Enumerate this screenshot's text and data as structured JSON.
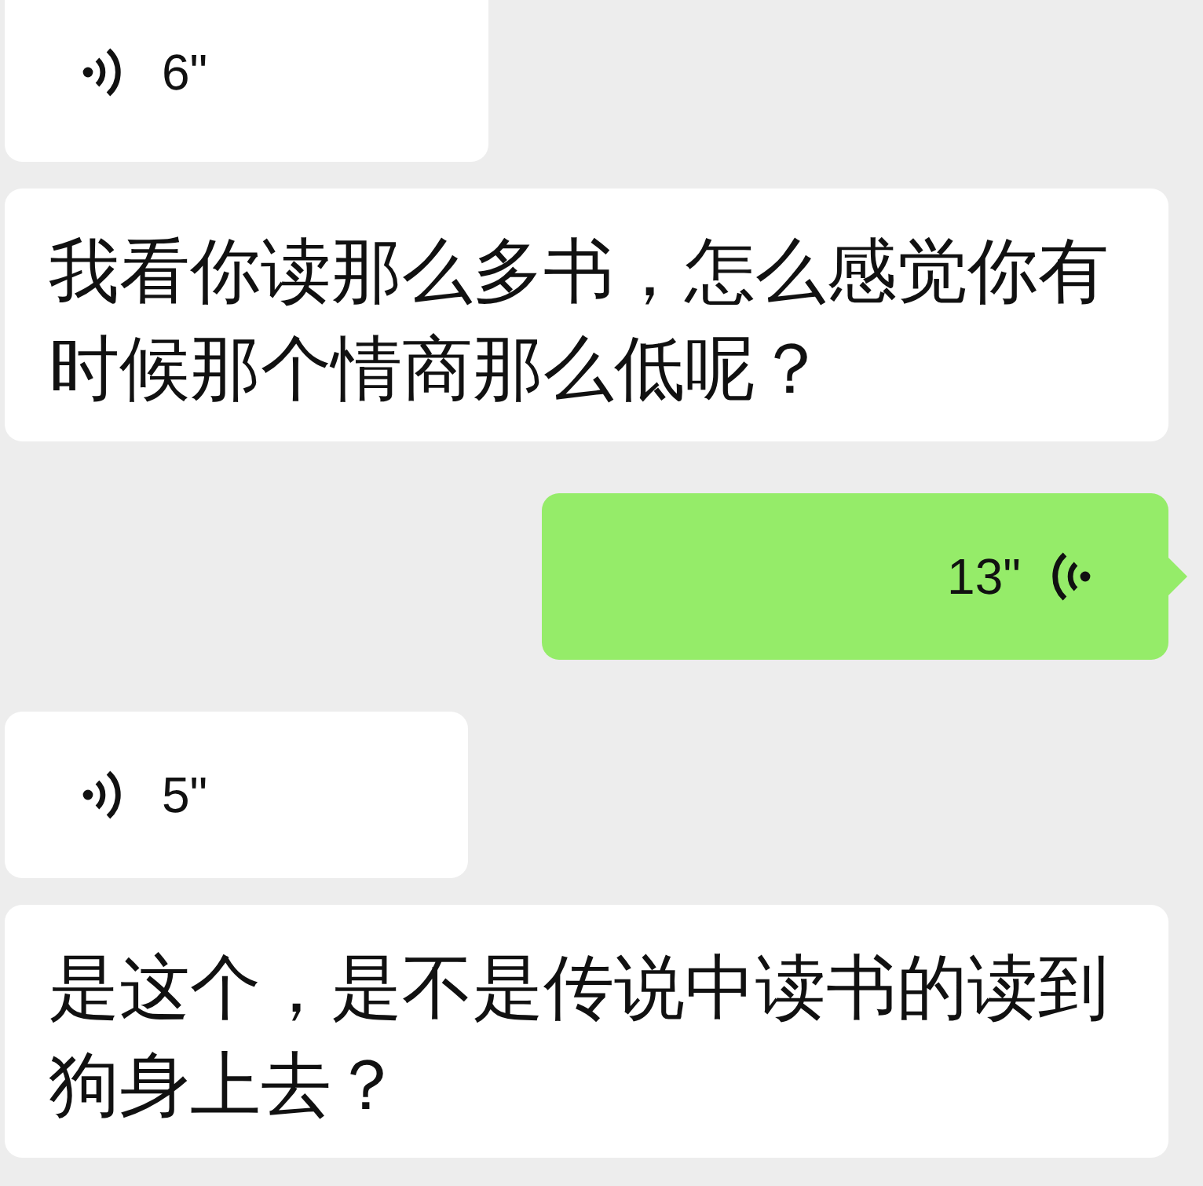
{
  "messages": [
    {
      "kind": "voice",
      "outgoing": false,
      "duration": "6\""
    },
    {
      "kind": "text",
      "outgoing": false,
      "text": "我看你读那么多书，怎么感觉你有时候那个情商那么低呢？"
    },
    {
      "kind": "voice",
      "outgoing": true,
      "duration": "13\""
    },
    {
      "kind": "voice",
      "outgoing": false,
      "duration": "5\""
    },
    {
      "kind": "text",
      "outgoing": false,
      "text": "是这个，是不是传说中读书的读到狗身上去？"
    }
  ]
}
